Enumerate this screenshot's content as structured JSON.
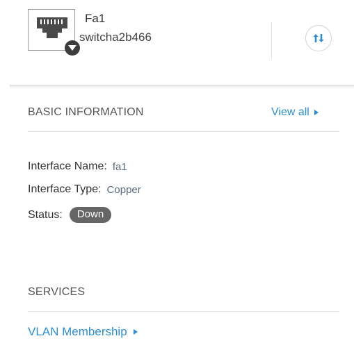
{
  "header": {
    "port_icon": "ethernet-port-icon",
    "caret_icon": "chevron-down-icon",
    "port_name": "Fa1",
    "device_name": "switcha2b466",
    "action_icon": "sort-arrows-icon"
  },
  "basic_info": {
    "title": "BASIC INFORMATION",
    "view_all_label": "View all",
    "view_all_icon": "triangle-right-icon",
    "fields": [
      {
        "label": "Interface Name:",
        "value": "fa1"
      },
      {
        "label": "Interface Type:",
        "value": "Copper"
      }
    ],
    "status_label": "Status:",
    "status_value": "Down"
  },
  "services": {
    "title": "SERVICES",
    "vlan_label": "VLAN Membership",
    "vlan_icon": "triangle-right-icon"
  },
  "colors": {
    "link": "#2b8fd6",
    "status_down_bg": "#666666",
    "action_icon": "#2b8fd6"
  }
}
